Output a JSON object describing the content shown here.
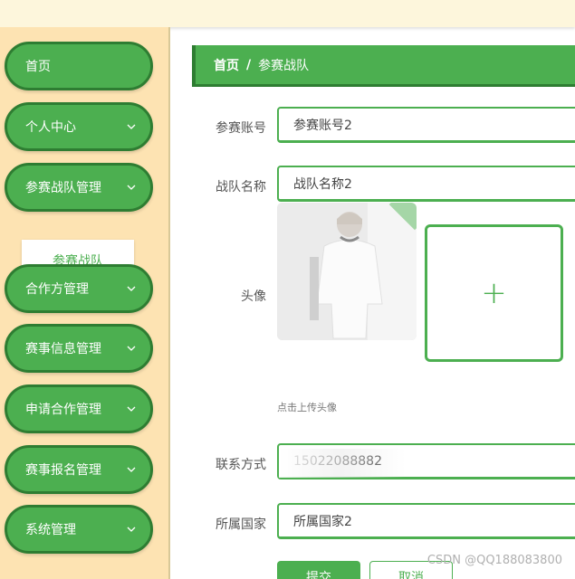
{
  "sidebar": {
    "items": [
      {
        "label": "首页",
        "expandable": false
      },
      {
        "label": "个人中心",
        "expandable": true
      },
      {
        "label": "参赛战队管理",
        "expandable": true
      },
      {
        "label": "合作方管理",
        "expandable": true
      },
      {
        "label": "赛事信息管理",
        "expandable": true
      },
      {
        "label": "申请合作管理",
        "expandable": true
      },
      {
        "label": "赛事报名管理",
        "expandable": true
      },
      {
        "label": "系统管理",
        "expandable": true
      }
    ],
    "sub_item": "参赛战队"
  },
  "breadcrumb": {
    "home": "首页",
    "separator": "/",
    "current": "参赛战队"
  },
  "form": {
    "account": {
      "label": "参赛账号",
      "value": "参赛账号2"
    },
    "team_name": {
      "label": "战队名称",
      "value": "战队名称2"
    },
    "avatar": {
      "label": "头像",
      "upload_symbol": "+",
      "tip": "点击上传头像"
    },
    "contact": {
      "label": "联系方式",
      "value": "15022088882"
    },
    "country": {
      "label": "所属国家",
      "value": "所属国家2"
    }
  },
  "buttons": {
    "submit": "提交",
    "cancel": "取消"
  },
  "watermark": "CSDN @QQ188083800",
  "colors": {
    "accent": "#4caf50",
    "accent_dark": "#2e7d32",
    "sidebar_bg": "#fde3b2",
    "topbar_bg": "#fdf6dc"
  },
  "icons": {
    "nav_chevron": "chevron-down-icon",
    "upload": "plus-icon"
  }
}
